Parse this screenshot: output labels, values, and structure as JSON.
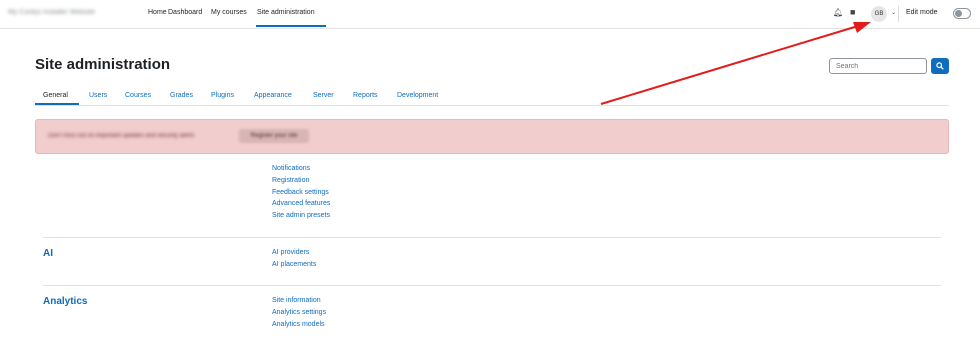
{
  "header": {
    "site_name": "My Cordys Installer Website",
    "nav": [
      "Home",
      "Dashboard",
      "My courses",
      "Site administration"
    ],
    "avatar_initials": "GB",
    "edit_mode_label": "Edit mode"
  },
  "page": {
    "title": "Site administration",
    "search_placeholder": "Search"
  },
  "tabs": [
    "General",
    "Users",
    "Courses",
    "Grades",
    "Plugins",
    "Appearance",
    "Server",
    "Reports",
    "Development"
  ],
  "alert": {
    "text": "Don't miss out on important updates and security alerts",
    "button": "Register your site"
  },
  "sections": {
    "general_links": [
      "Notifications",
      "Registration",
      "Feedback settings",
      "Advanced features",
      "Site admin presets"
    ],
    "ai": {
      "title": "AI",
      "links": [
        "AI providers",
        "AI placements"
      ]
    },
    "analytics": {
      "title": "Analytics",
      "links": [
        "Site information",
        "Analytics settings",
        "Analytics models"
      ]
    }
  },
  "colors": {
    "accent": "#0f6cbf",
    "alert_bg": "#f1cdcd",
    "arrow": "#e21b1b"
  }
}
